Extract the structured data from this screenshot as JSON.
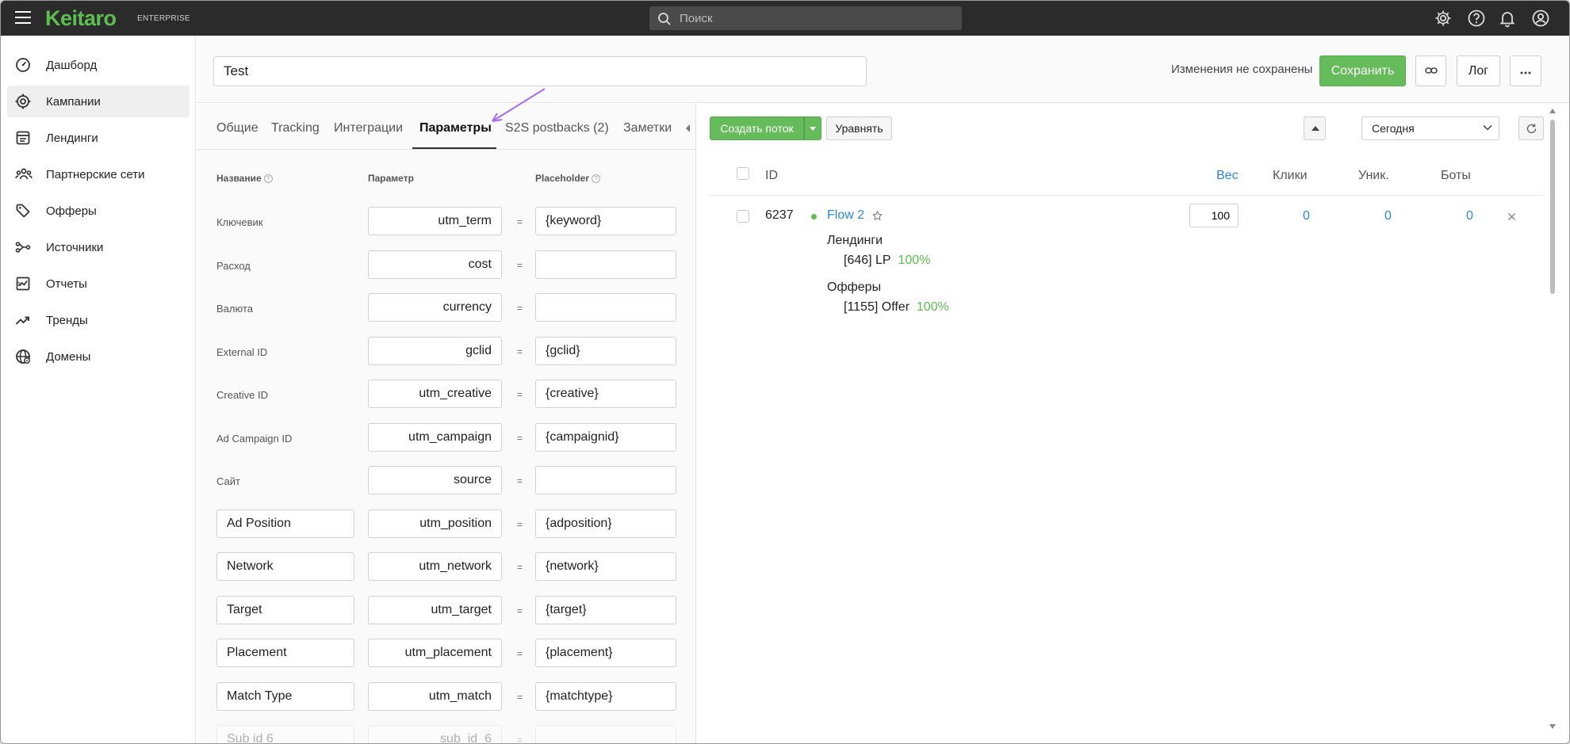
{
  "app": {
    "logo": "Keitaro",
    "edition": "ENTERPRISE"
  },
  "search": {
    "placeholder": "Поиск"
  },
  "top_icons": [
    "gear-icon",
    "help-icon",
    "bell-icon",
    "account-icon"
  ],
  "sidebar": {
    "items": [
      {
        "label": "Дашборд",
        "icon": "dashboard-icon",
        "active": false
      },
      {
        "label": "Кампании",
        "icon": "target-icon",
        "active": true
      },
      {
        "label": "Лендинги",
        "icon": "landing-icon",
        "active": false
      },
      {
        "label": "Партнерские сети",
        "icon": "people-icon",
        "active": false
      },
      {
        "label": "Офферы",
        "icon": "tag-icon",
        "active": false
      },
      {
        "label": "Источники",
        "icon": "source-icon",
        "active": false
      },
      {
        "label": "Отчеты",
        "icon": "report-icon",
        "active": false,
        "has_children": true
      },
      {
        "label": "Тренды",
        "icon": "trend-icon",
        "active": false
      },
      {
        "label": "Домены",
        "icon": "globe-icon",
        "active": false
      }
    ]
  },
  "header": {
    "campaign_name": "Test",
    "unsaved_text": "Изменения не сохранены",
    "save_label": "Сохранить",
    "log_label": "Лог",
    "more_label": "···"
  },
  "tabs": [
    {
      "label": "Общие",
      "active": false
    },
    {
      "label": "Tracking",
      "active": false
    },
    {
      "label": "Интеграции",
      "active": false
    },
    {
      "label": "Параметры",
      "active": true
    },
    {
      "label": "S2S postbacks (2)",
      "active": false
    },
    {
      "label": "Заметки",
      "active": false
    }
  ],
  "params": {
    "headers": {
      "name": "Название",
      "param": "Параметр",
      "placeholder": "Placeholder"
    },
    "eq": "=",
    "fixed_rows": [
      {
        "name": "Ключевик",
        "param": "utm_term",
        "placeholder": "{keyword}"
      },
      {
        "name": "Расход",
        "param": "cost",
        "placeholder": ""
      },
      {
        "name": "Валюта",
        "param": "currency",
        "placeholder": ""
      },
      {
        "name": "External ID",
        "param": "gclid",
        "placeholder": "{gclid}"
      },
      {
        "name": "Creative ID",
        "param": "utm_creative",
        "placeholder": "{creative}"
      },
      {
        "name": "Ad Campaign ID",
        "param": "utm_campaign",
        "placeholder": "{campaignid}"
      },
      {
        "name": "Сайт",
        "param": "source",
        "placeholder": ""
      }
    ],
    "custom_rows": [
      {
        "name": "Ad Position",
        "param": "utm_position",
        "placeholder": "{adposition}"
      },
      {
        "name": "Network",
        "param": "utm_network",
        "placeholder": "{network}"
      },
      {
        "name": "Target",
        "param": "utm_target",
        "placeholder": "{target}"
      },
      {
        "name": "Placement",
        "param": "utm_placement",
        "placeholder": "{placement}"
      },
      {
        "name": "Match Type",
        "param": "utm_match",
        "placeholder": "{matchtype}"
      },
      {
        "name": "Sub id 6",
        "param": "sub_id_6",
        "placeholder": ""
      }
    ]
  },
  "flows": {
    "create_label": "Создать поток",
    "equalize_label": "Уравнять",
    "date_range": "Сегодня",
    "columns": {
      "id": "ID",
      "weight": "Вес",
      "clicks": "Клики",
      "unique": "Уник.",
      "bots": "Боты"
    },
    "rows": [
      {
        "id": "6237",
        "name": "Flow 2",
        "weight": "100",
        "clicks": "0",
        "unique": "0",
        "bots": "0",
        "landings_label": "Лендинги",
        "landing": "[646] LP",
        "landing_share": "100%",
        "offers_label": "Офферы",
        "offer": "[1155] Offer",
        "offer_share": "100%"
      }
    ]
  },
  "colors": {
    "accent_green": "#66bb5b",
    "link_blue": "#2c88d9",
    "topbar": "#2b2b2b",
    "annotation_arrow": "#a66bf0"
  }
}
